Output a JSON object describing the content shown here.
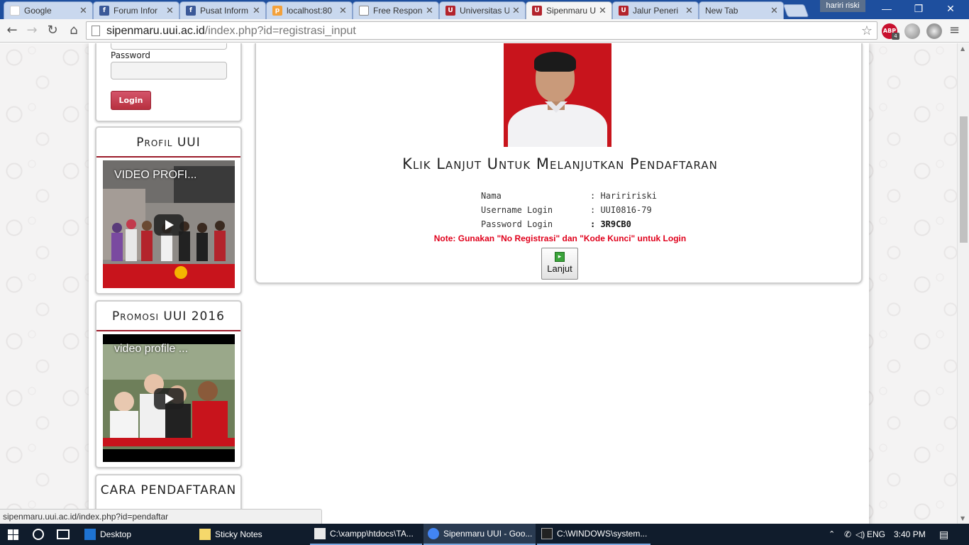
{
  "browser": {
    "tabs": [
      {
        "title": "Google",
        "icon": "google-icon",
        "active": false
      },
      {
        "title": "Forum Infor",
        "icon": "facebook-icon",
        "active": false
      },
      {
        "title": "Pusat Inform",
        "icon": "facebook-icon",
        "active": false
      },
      {
        "title": "localhost:80",
        "icon": "phpmyadmin-icon",
        "active": false
      },
      {
        "title": "Free Respon",
        "icon": "document-icon",
        "active": false
      },
      {
        "title": "Universitas U",
        "icon": "uui-icon",
        "active": false
      },
      {
        "title": "Sipenmaru U",
        "icon": "uui-icon",
        "active": true
      },
      {
        "title": "Jalur Peneri",
        "icon": "uui-icon",
        "active": false
      },
      {
        "title": "New Tab",
        "icon": "",
        "active": false
      }
    ],
    "profile_name": "hariri riski",
    "address": {
      "host": "sipenmaru.uui.ac.id",
      "path": "/index.php?id=registrasi_input"
    },
    "abp_badge": "4",
    "status_url": "sipenmaru.uui.ac.id/index.php?id=pendaftar"
  },
  "sidebar": {
    "password_label": "Password",
    "login_button": "Login",
    "profil_title": "Profil UUI",
    "profil_video_title": "VIDEO PROFI...",
    "promosi_title": "Promosi UUI 2016",
    "promosi_video_title": "video profile ...",
    "cara_title": "CARA PENDAFTARAN"
  },
  "main": {
    "heading": "Klik Lanjut Untuk Melanjutkan Pendaftaran",
    "info": [
      {
        "label": "Nama",
        "value": ": Hariririski",
        "bold": false
      },
      {
        "label": "Username Login",
        "value": ": UUI0816-79",
        "bold": false
      },
      {
        "label": "Password Login",
        "value": ": 3R9CB0",
        "bold": true
      }
    ],
    "note": "Note: Gunakan \"No Registrasi\" dan \"Kode Kunci\" untuk Login",
    "continue_button": "Lanjut"
  },
  "taskbar": {
    "items": [
      {
        "label": "Desktop",
        "icon": "desktop-icon",
        "color": "#1e73d2"
      },
      {
        "label": "Sticky Notes",
        "icon": "sticky-notes-icon",
        "color": "#f5d86b"
      },
      {
        "label": "C:\\xampp\\htdocs\\TA...",
        "icon": "notepad-icon",
        "color": "#e9e9e9"
      },
      {
        "label": "Sipenmaru UUI - Goo...",
        "icon": "chrome-icon",
        "color": "#4285f4"
      },
      {
        "label": "C:\\WINDOWS\\system...",
        "icon": "cmd-icon",
        "color": "#222222"
      }
    ],
    "language": "ENG",
    "time": "3:40 PM"
  },
  "colors": {
    "accent": "#9b1b2a",
    "note": "#e0001b",
    "login_button": "#c23a4c",
    "taskbar": "#101c2c"
  }
}
